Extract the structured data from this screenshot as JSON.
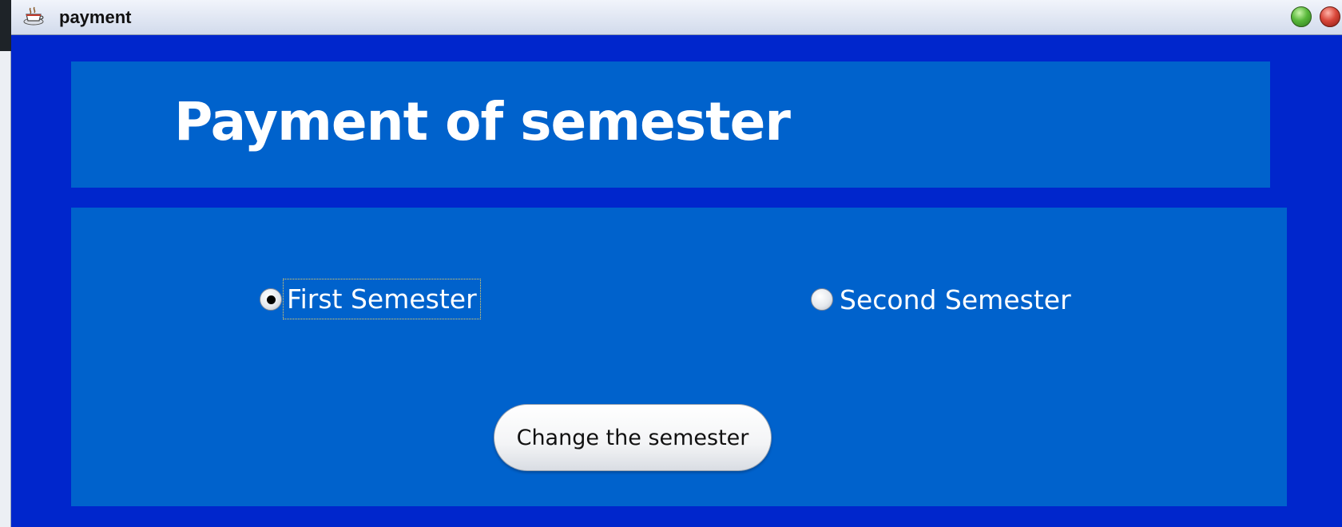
{
  "window": {
    "title": "payment"
  },
  "header": {
    "title": "Payment of semester"
  },
  "semester_options": [
    {
      "label": "First Semester",
      "selected": true
    },
    {
      "label": "Second Semester",
      "selected": false
    }
  ],
  "actions": {
    "change_label": "Change the semester"
  },
  "colors": {
    "window_bg": "#0026cc",
    "panel_bg": "#0062cc",
    "text": "#ffffff"
  }
}
